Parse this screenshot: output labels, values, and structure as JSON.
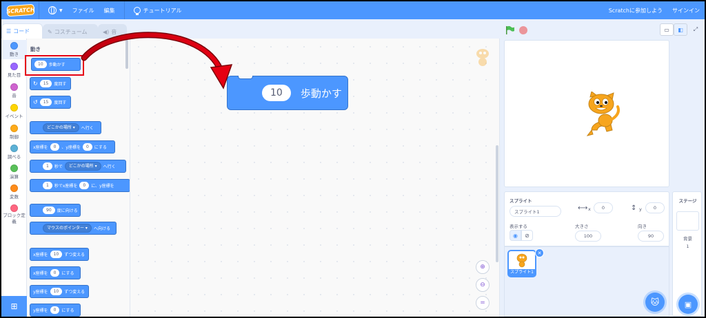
{
  "menubar": {
    "logo": "SCRATCH",
    "file": "ファイル",
    "edit": "編集",
    "tutorials": "チュートリアル",
    "join": "Scratchに参加しよう",
    "signin": "サインイン"
  },
  "tabs": [
    {
      "label": "コード"
    },
    {
      "label": "コスチューム"
    },
    {
      "label": "音"
    }
  ],
  "categories": [
    {
      "label": "動き",
      "color": "#4c97ff"
    },
    {
      "label": "見た目",
      "color": "#9966ff"
    },
    {
      "label": "音",
      "color": "#cf63cf"
    },
    {
      "label": "イベント",
      "color": "#ffd500"
    },
    {
      "label": "制御",
      "color": "#ffab19"
    },
    {
      "label": "調べる",
      "color": "#5cb1d6"
    },
    {
      "label": "演算",
      "color": "#59c059"
    },
    {
      "label": "変数",
      "color": "#ff8c1a"
    },
    {
      "label": "ブロック定義",
      "color": "#ff6680"
    }
  ],
  "palette": {
    "section_title": "動き",
    "blocks": {
      "move_num": "10",
      "move_text": "歩動かす",
      "turn_right_num": "15",
      "turn_right_text": "度回す",
      "turn_left_num": "15",
      "turn_left_text": "度回す",
      "goto_dd": "どこかの場所",
      "goto_text": "へ行く",
      "gotoxy_a": "x座標を",
      "gotoxy_x": "0",
      "gotoxy_b": "、y座標を",
      "gotoxy_y": "0",
      "gotoxy_c": "にする",
      "glide_num": "1",
      "glide_a": "秒で",
      "glide_dd": "どこかの場所",
      "glide_b": "へ行く",
      "glidexy_num": "1",
      "glidexy_a": "秒でx座標を",
      "glidexy_x": "0",
      "glidexy_b": "に、y座標を",
      "point_num": "90",
      "point_text": "度に向ける",
      "towards_dd": "マウスのポインター",
      "towards_text": "へ向ける",
      "changex_a": "x座標を",
      "changex_num": "10",
      "changex_b": "ずつ変える",
      "setx_a": "x座標を",
      "setx_num": "0",
      "setx_b": "にする",
      "changey_a": "y座標を",
      "changey_num": "10",
      "changey_b": "ずつ変える",
      "sety_a": "y座標を",
      "sety_num": "0",
      "sety_b": "にする"
    }
  },
  "script": {
    "block_num": "10",
    "block_text": "歩動かす"
  },
  "sprite_info": {
    "title": "スプライト",
    "name": "スプライト1",
    "x_label": "x",
    "x_value": "0",
    "y_label": "y",
    "y_value": "0",
    "show_label": "表示する",
    "size_label": "大きさ",
    "size_value": "100",
    "direction_label": "向き",
    "direction_value": "90"
  },
  "sprite_list": [
    {
      "name": "スプライト1"
    }
  ],
  "stage_selector": {
    "title": "ステージ",
    "backdrops_label": "背景",
    "backdrops_count": "1"
  }
}
